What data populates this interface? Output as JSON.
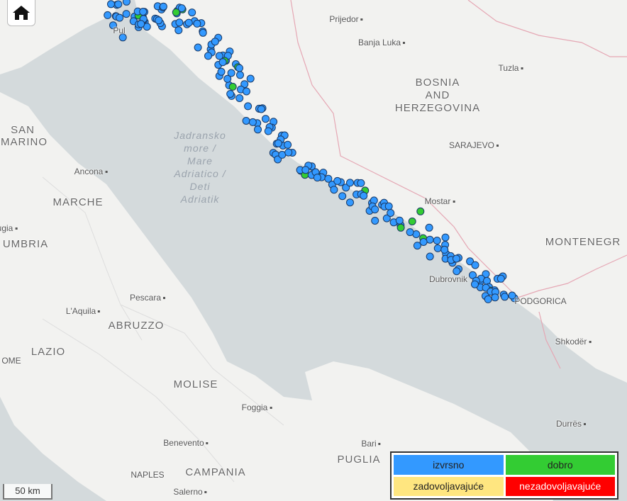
{
  "colors": {
    "sea": "#d4dadc",
    "land": "#f2f2f0",
    "excellent": "#3399ff",
    "good": "#33cc33",
    "satisfactory": "#ffe680",
    "poor": "#ff0000"
  },
  "labels": {
    "prijedor": "Prijedor",
    "banja_luka": "Banja Luka",
    "tuzla": "Tuzla",
    "bosnia": "BOSNIA",
    "and": "AND",
    "herzegovina": "HERZEGOVINA",
    "sarajevo": "SARAJEVO",
    "mostar": "Mostar",
    "montenegro": "MONTENEGR",
    "podgorica": "PODGORICA",
    "dubrovnik": "Dubrovnik",
    "shkoder": "Shkodër",
    "durres": "Durrës",
    "san": "SAN",
    "marino": "MARINO",
    "ancona": "Ancona",
    "marche": "MARCHE",
    "umbria": "UMBRIA",
    "perugia": "ugia",
    "pescara": "Pescara",
    "laquila": "L'Aquila",
    "abruzzo": "ABRUZZO",
    "lazio": "LAZIO",
    "rome": "OME",
    "molise": "MOLISE",
    "foggia": "Foggia",
    "bari": "Bari",
    "puglia": "PUGLIA",
    "benevento": "Benevento",
    "napoli": "NAPLES",
    "campania": "CAMPANIA",
    "salerno": "Salerno",
    "pula": "Pul",
    "sea1": "Jadransko",
    "sea2": "more /",
    "sea3": "Mare",
    "sea4": "Adriatico /",
    "sea5": "Deti",
    "sea6": "Adriatik"
  },
  "scale": "50 km",
  "home_icon": "home-icon",
  "legend": [
    {
      "label": "izvrsno",
      "color": "#3399ff"
    },
    {
      "label": "dobro",
      "color": "#33cc33"
    },
    {
      "label": "zadovoljavajuće",
      "color": "#ffe680"
    },
    {
      "label": "nezadovoljavajuće",
      "color": "#ff0000"
    }
  ]
}
